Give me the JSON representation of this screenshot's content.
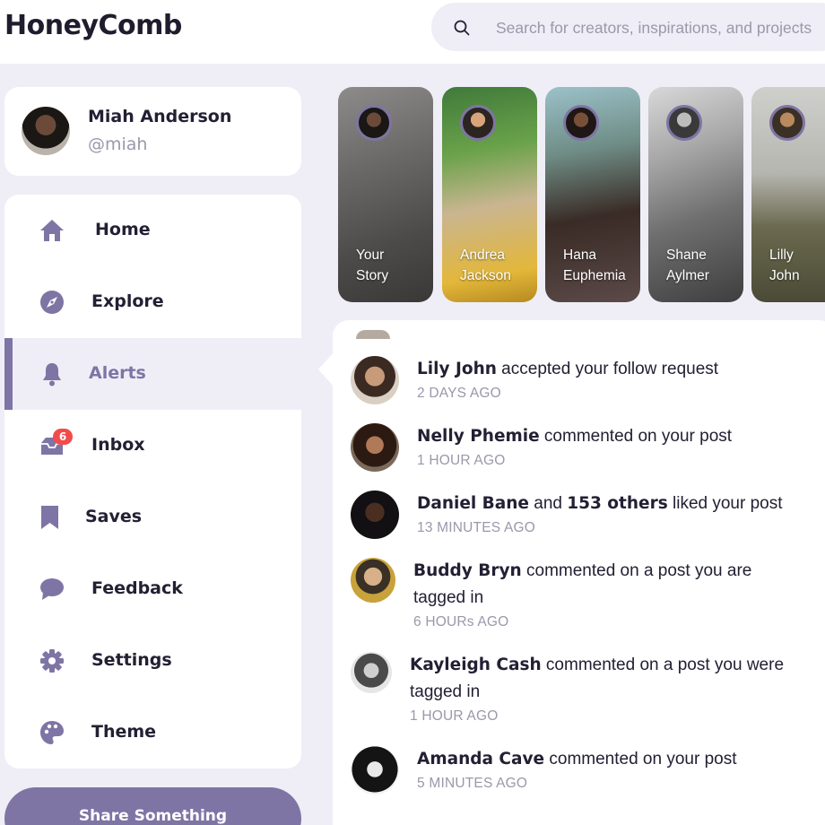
{
  "app": {
    "title": "HoneyComb"
  },
  "search": {
    "placeholder": "Search for creators, inspirations, and projects"
  },
  "profile": {
    "name": "Miah Anderson",
    "handle": "@miah"
  },
  "sidebar": {
    "items": [
      {
        "label": "Home",
        "icon": "home-icon",
        "active": false
      },
      {
        "label": "Explore",
        "icon": "compass-icon",
        "active": false
      },
      {
        "label": "Alerts",
        "icon": "bell-icon",
        "active": true
      },
      {
        "label": "Inbox",
        "icon": "inbox-icon",
        "active": false,
        "badge": "6"
      },
      {
        "label": "Saves",
        "icon": "bookmark-icon",
        "active": false
      },
      {
        "label": "Feedback",
        "icon": "chat-bubble-icon",
        "active": false
      },
      {
        "label": "Settings",
        "icon": "gear-icon",
        "active": false
      },
      {
        "label": "Theme",
        "icon": "palette-icon",
        "active": false
      }
    ],
    "share_label": "Share Something"
  },
  "stories": [
    {
      "line1": "Your",
      "line2": "Story"
    },
    {
      "line1": "Andrea",
      "line2": "Jackson"
    },
    {
      "line1": "Hana",
      "line2": "Euphemia"
    },
    {
      "line1": "Shane",
      "line2": "Aylmer"
    },
    {
      "line1": "Lilly",
      "line2": "John"
    }
  ],
  "notifications": [
    {
      "name": "Lily John",
      "text": " accepted your follow request",
      "time": "2 DAYS AGO"
    },
    {
      "name": "Nelly Phemie",
      "text": " commented on your post",
      "time": "1 HOUR AGO"
    },
    {
      "name": "Daniel Bane",
      "text_mid": " and ",
      "name2": "153 others",
      "text": " liked your post",
      "time": "13 MINUTES AGO"
    },
    {
      "name": "Buddy Bryn",
      "text": " commented on a post you are",
      "text2": "tagged in",
      "time": "6 HOURs AGO"
    },
    {
      "name": "Kayleigh Cash",
      "text": " commented on a post you were",
      "text2": "tagged in",
      "time": "1 HOUR AGO"
    },
    {
      "name": "Amanda Cave",
      "text": " commented on your post",
      "time": "5 MINUTES AGO"
    }
  ],
  "colors": {
    "accent": "#7e75a5",
    "background": "#efeef6",
    "badge": "#f14b4b",
    "muted": "#9a98aa"
  }
}
